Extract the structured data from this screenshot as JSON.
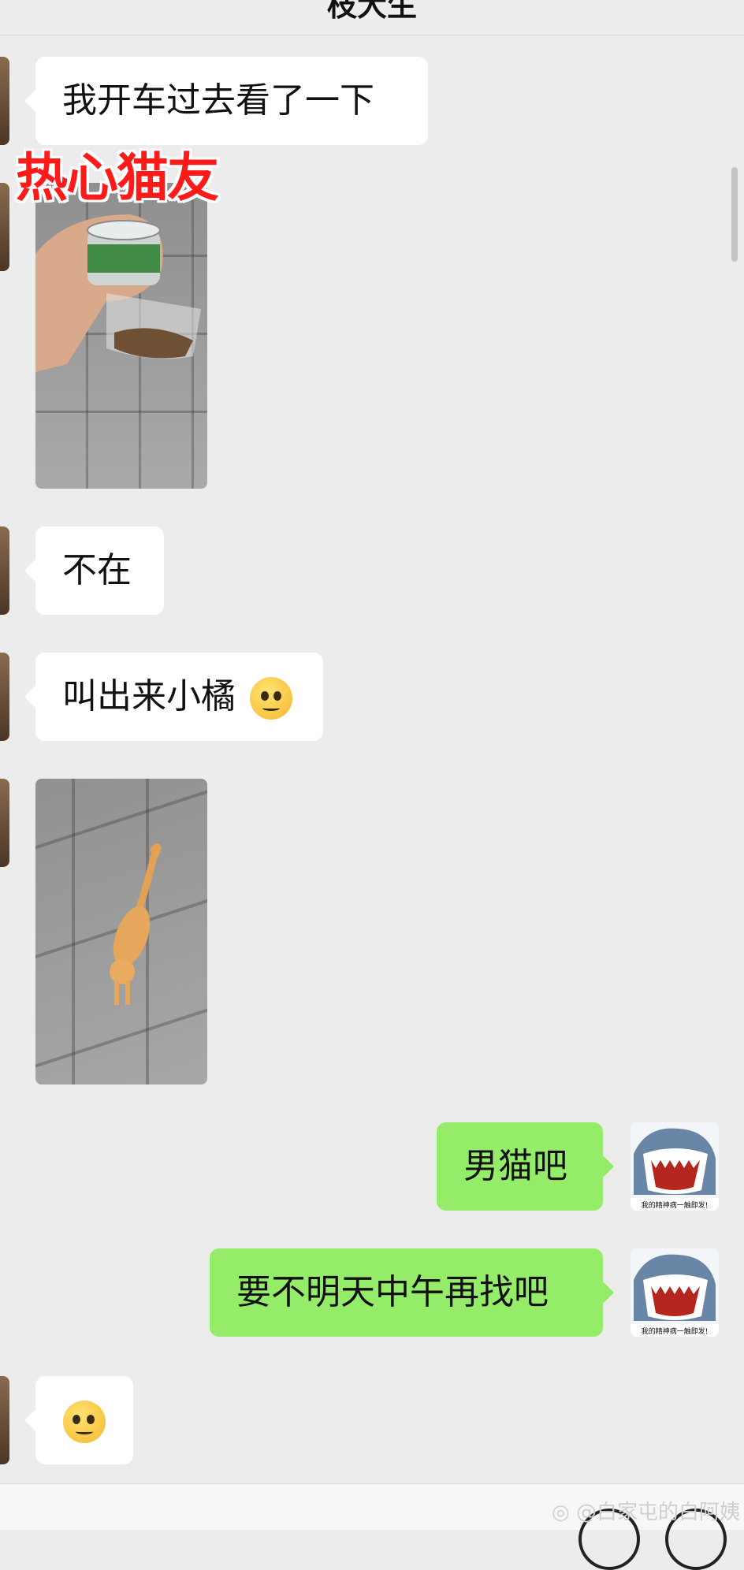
{
  "header": {
    "title": "枝大生"
  },
  "messages": {
    "m1_text": "我开车过去看了一下",
    "m2_sticker_text": "热心猫友",
    "m4_text": "不在",
    "m5_text": "叫出来小橘",
    "m7_text": "男猫吧",
    "m8_text": "要不明天中午再找吧",
    "avatar_caption": "我的精神病一触即发!"
  },
  "footer": {
    "watermark": "@白家屯的白阿姨"
  },
  "colors": {
    "incoming_bubble": "#ffffff",
    "outgoing_bubble": "#95ec69",
    "background": "#ececec",
    "sticker_red": "#ff1a1a"
  },
  "icons": [
    "emoji-woozy-icon",
    "emoji-shrug-face-icon",
    "weibo-logo-icon"
  ]
}
